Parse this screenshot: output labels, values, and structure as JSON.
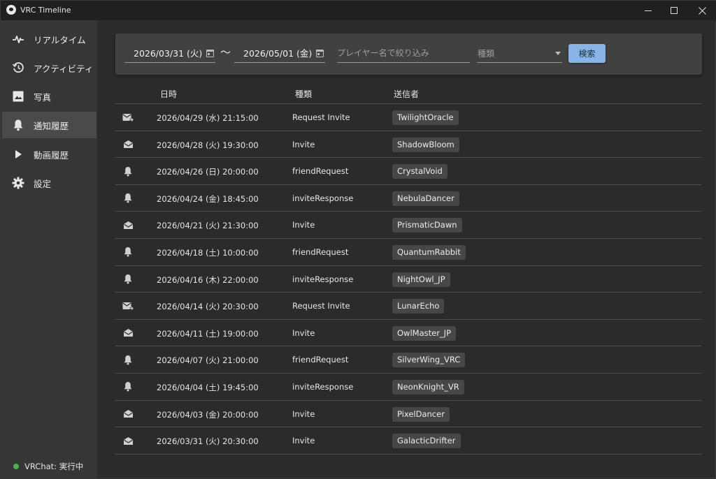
{
  "app": {
    "title": "VRC Timeline"
  },
  "sidebar": {
    "items": [
      {
        "label": "リアルタイム",
        "icon": "pulse-icon"
      },
      {
        "label": "アクティビティ",
        "icon": "history-icon"
      },
      {
        "label": "写真",
        "icon": "image-icon"
      },
      {
        "label": "通知履歴",
        "icon": "bell-icon",
        "active": true
      },
      {
        "label": "動画履歴",
        "icon": "play-icon"
      },
      {
        "label": "設定",
        "icon": "gear-icon"
      }
    ],
    "status": {
      "text": "VRChat: 実行中",
      "color": "#4caf50"
    }
  },
  "filter": {
    "date_from": "2026/03/31 (火)",
    "separator": "〜",
    "date_to": "2026/05/01 (金)",
    "player_placeholder": "プレイヤー名で絞り込み",
    "type_placeholder": "種類",
    "search_button": "検索",
    "accent": "#8ab4e8"
  },
  "table": {
    "headers": {
      "datetime": "日時",
      "type": "種類",
      "sender": "送信者"
    },
    "rows": [
      {
        "icon": "mail-forward-icon",
        "datetime": "2026/04/29 (水) 21:15:00",
        "type": "Request Invite",
        "sender": "TwilightOracle"
      },
      {
        "icon": "mail-open-icon",
        "datetime": "2026/04/28 (火) 19:30:00",
        "type": "Invite",
        "sender": "ShadowBloom"
      },
      {
        "icon": "bell-icon",
        "datetime": "2026/04/26 (日) 20:00:00",
        "type": "friendRequest",
        "sender": "CrystalVoid"
      },
      {
        "icon": "bell-icon",
        "datetime": "2026/04/24 (金) 18:45:00",
        "type": "inviteResponse",
        "sender": "NebulaDancer"
      },
      {
        "icon": "mail-open-icon",
        "datetime": "2026/04/21 (火) 21:30:00",
        "type": "Invite",
        "sender": "PrismaticDawn"
      },
      {
        "icon": "bell-icon",
        "datetime": "2026/04/18 (土) 10:00:00",
        "type": "friendRequest",
        "sender": "QuantumRabbit"
      },
      {
        "icon": "bell-icon",
        "datetime": "2026/04/16 (木) 22:00:00",
        "type": "inviteResponse",
        "sender": "NightOwl_JP"
      },
      {
        "icon": "mail-forward-icon",
        "datetime": "2026/04/14 (火) 20:30:00",
        "type": "Request Invite",
        "sender": "LunarEcho"
      },
      {
        "icon": "mail-open-icon",
        "datetime": "2026/04/11 (土) 19:00:00",
        "type": "Invite",
        "sender": "OwlMaster_JP"
      },
      {
        "icon": "bell-icon",
        "datetime": "2026/04/07 (火) 21:00:00",
        "type": "friendRequest",
        "sender": "SilverWing_VRC"
      },
      {
        "icon": "bell-icon",
        "datetime": "2026/04/04 (土) 19:45:00",
        "type": "inviteResponse",
        "sender": "NeonKnight_VR"
      },
      {
        "icon": "mail-open-icon",
        "datetime": "2026/04/03 (金) 20:00:00",
        "type": "Invite",
        "sender": "PixelDancer"
      },
      {
        "icon": "mail-open-icon",
        "datetime": "2026/03/31 (火) 20:30:00",
        "type": "Invite",
        "sender": "GalacticDrifter"
      }
    ]
  }
}
